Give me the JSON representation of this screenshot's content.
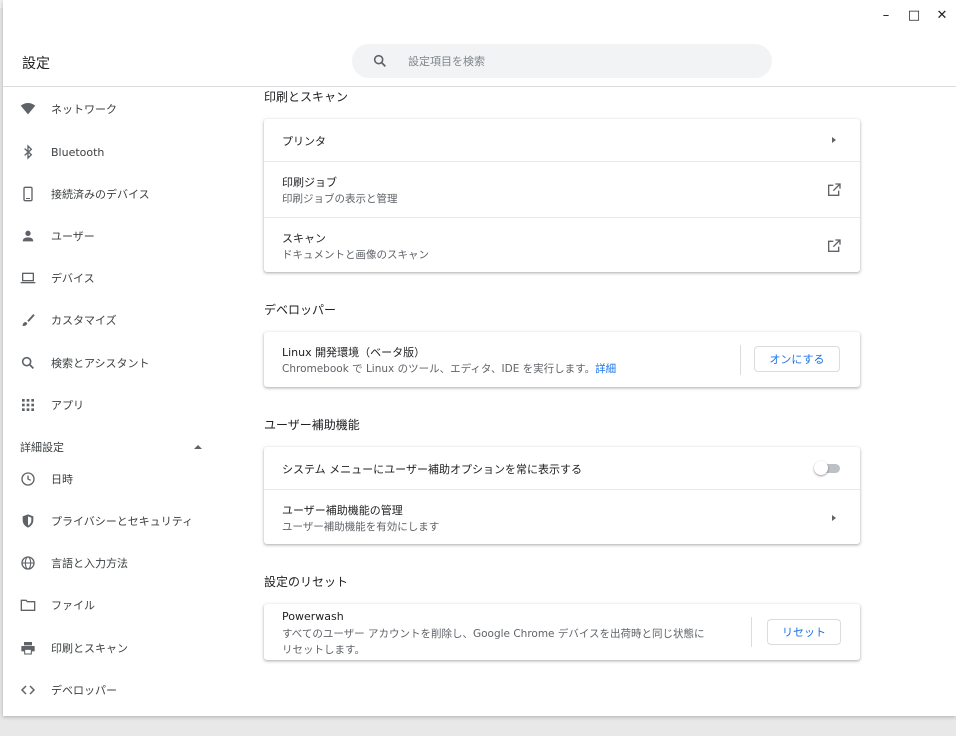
{
  "window": {
    "minimize": "–",
    "maximize": "□",
    "close": "✕"
  },
  "app": {
    "title": "設定"
  },
  "search": {
    "placeholder": "設定項目を検索"
  },
  "sidebar": {
    "items": [
      {
        "label": "ネットワーク",
        "icon": "wifi-icon"
      },
      {
        "label": "Bluetooth",
        "icon": "bluetooth-icon"
      },
      {
        "label": "接続済みのデバイス",
        "icon": "phone-icon"
      },
      {
        "label": "ユーザー",
        "icon": "person-icon"
      },
      {
        "label": "デバイス",
        "icon": "laptop-icon"
      },
      {
        "label": "カスタマイズ",
        "icon": "brush-icon"
      },
      {
        "label": "検索とアシスタント",
        "icon": "search-icon"
      },
      {
        "label": "アプリ",
        "icon": "apps-grid-icon"
      }
    ],
    "advanced_label": "詳細設定",
    "advanced_items": [
      {
        "label": "日時",
        "icon": "clock-icon"
      },
      {
        "label": "プライバシーとセキュリティ",
        "icon": "shield-icon"
      },
      {
        "label": "言語と入力方法",
        "icon": "globe-icon"
      },
      {
        "label": "ファイル",
        "icon": "folder-icon"
      },
      {
        "label": "印刷とスキャン",
        "icon": "printer-icon"
      },
      {
        "label": "デベロッパー",
        "icon": "code-icon"
      }
    ]
  },
  "print": {
    "title": "印刷とスキャン",
    "printer": "プリンタ",
    "jobs_title": "印刷ジョブ",
    "jobs_sub": "印刷ジョブの表示と管理",
    "scan_title": "スキャン",
    "scan_sub": "ドキュメントと画像のスキャン"
  },
  "developer": {
    "title": "デベロッパー",
    "linux_title": "Linux 開発環境（ベータ版）",
    "linux_sub": "Chromebook で Linux のツール、エディタ、IDE を実行します。",
    "linux_link": "詳細",
    "enable_button": "オンにする"
  },
  "accessibility": {
    "title": "ユーザー補助機能",
    "always_show": "システム メニューにユーザー補助オプションを常に表示する",
    "always_show_on": false,
    "manage_title": "ユーザー補助機能の管理",
    "manage_sub": "ユーザー補助機能を有効にします"
  },
  "reset": {
    "title": "設定のリセット",
    "powerwash_title": "Powerwash",
    "powerwash_sub_line1": "すべてのユーザー アカウントを削除し、Google Chrome デバイスを出荷時と同じ状態に",
    "powerwash_sub_line2": "リセットします。",
    "reset_button": "リセット"
  },
  "colors": {
    "accent": "#1a73e8",
    "icon": "#5f6368",
    "text": "#202124"
  }
}
